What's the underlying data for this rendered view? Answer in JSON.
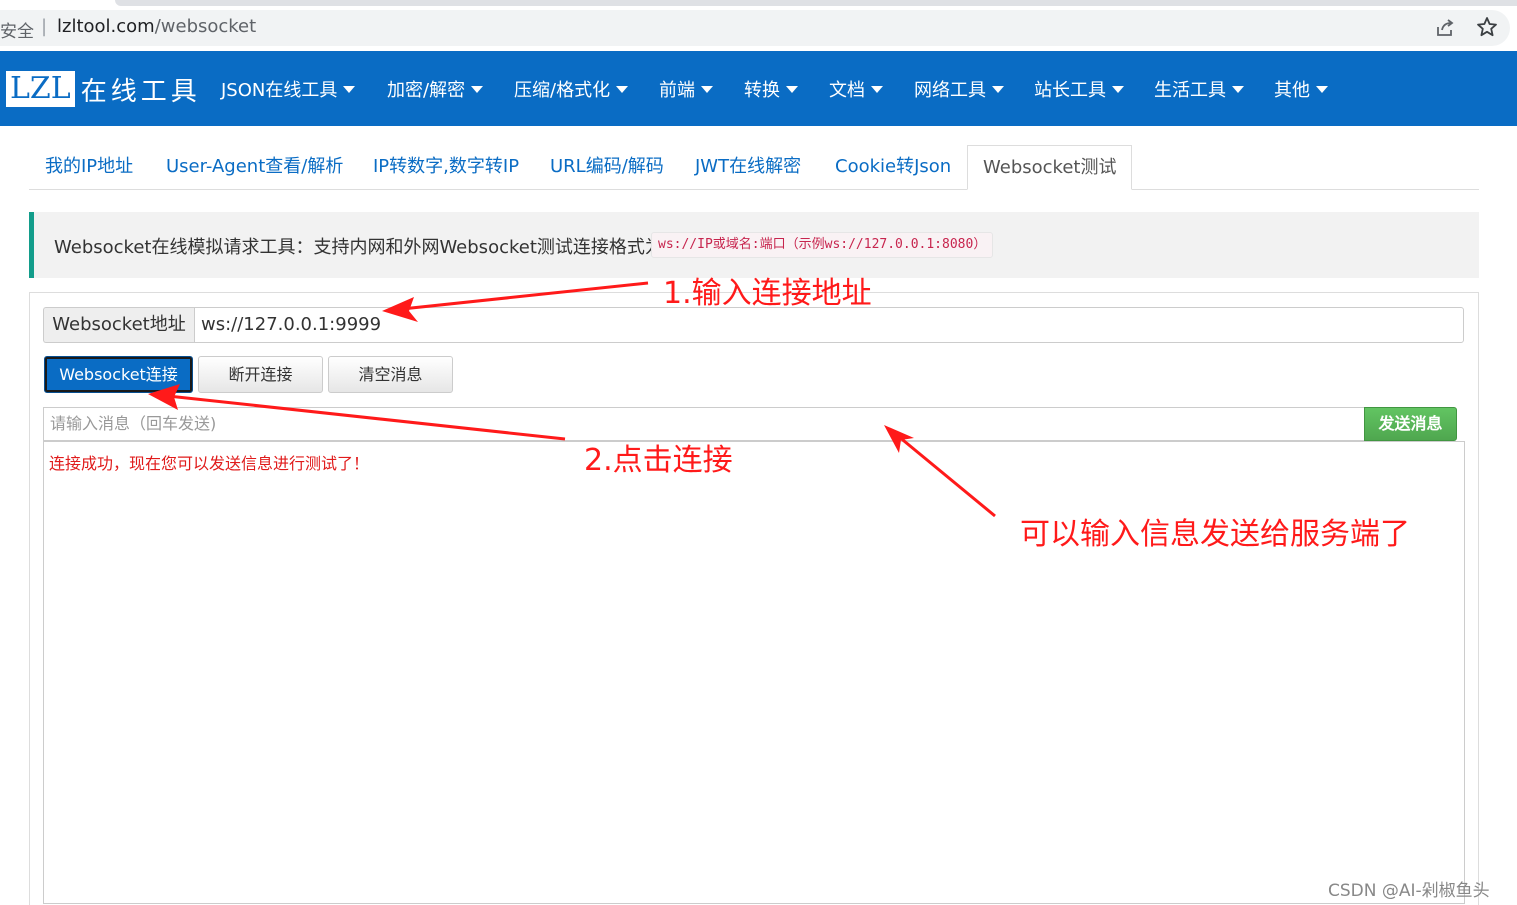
{
  "browser": {
    "security_label": "安全",
    "separator": "|",
    "url_host": "lzltool.com",
    "url_path": "/websocket"
  },
  "site": {
    "logo_box": "LZL",
    "logo_text": "在线工具",
    "brand_color": "#0a6cc4",
    "nav": [
      {
        "label": "JSON在线工具"
      },
      {
        "label": "加密/解密"
      },
      {
        "label": "压缩/格式化"
      },
      {
        "label": "前端"
      },
      {
        "label": "转换"
      },
      {
        "label": "文档"
      },
      {
        "label": "网络工具"
      },
      {
        "label": "站长工具"
      },
      {
        "label": "生活工具"
      },
      {
        "label": "其他"
      }
    ]
  },
  "tabs": [
    {
      "label": "我的IP地址"
    },
    {
      "label": "User-Agent查看/解析"
    },
    {
      "label": "IP转数字,数字转IP"
    },
    {
      "label": "URL编码/解码"
    },
    {
      "label": "JWT在线解密"
    },
    {
      "label": "Cookie转Json"
    },
    {
      "label": "Websocket测试",
      "active": true
    }
  ],
  "callout": {
    "text": "Websocket在线模拟请求工具：支持内网和外网Websocket测试连接格式为",
    "code": "ws://IP或域名:端口（示例ws://127.0.0.1:8080）"
  },
  "form": {
    "address_label": "Websocket地址",
    "address_value": "ws://127.0.0.1:9999",
    "connect_label": "Websocket连接",
    "disconnect_label": "断开连接",
    "clear_label": "清空消息",
    "message_placeholder": "请输入消息（回车发送)",
    "send_label": "发送消息",
    "log_message": "连接成功，现在您可以发送信息进行测试了！"
  },
  "annotations": {
    "step1": "1.输入连接地址",
    "step2": "2.点击连接",
    "step3": "可以输入信息发送给服务端了",
    "color": "#ff1a1a"
  },
  "watermark": "CSDN @AI-剁椒鱼头"
}
